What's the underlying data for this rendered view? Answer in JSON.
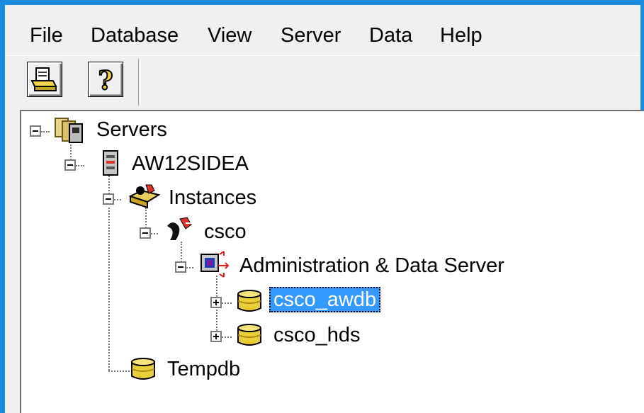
{
  "menu": {
    "file": "File",
    "database": "Database",
    "view": "View",
    "server": "Server",
    "data": "Data",
    "help": "Help"
  },
  "toolbar": {
    "buttons": [
      {
        "icon": "print-preview-icon"
      },
      {
        "icon": "help-icon",
        "glyph": "?"
      }
    ]
  },
  "tree": {
    "servers": "Servers",
    "server_node": "AW12SIDEA",
    "instances": "Instances",
    "instance_node": "csco",
    "admin_data_server": "Administration & Data Server",
    "db_awdb": "csco_awdb",
    "db_hds": "csco_hds",
    "tempdb": "Tempdb",
    "selected": "csco_awdb"
  },
  "colors": {
    "selection": "#3399ff",
    "window_frame": "#1a8ce0"
  }
}
